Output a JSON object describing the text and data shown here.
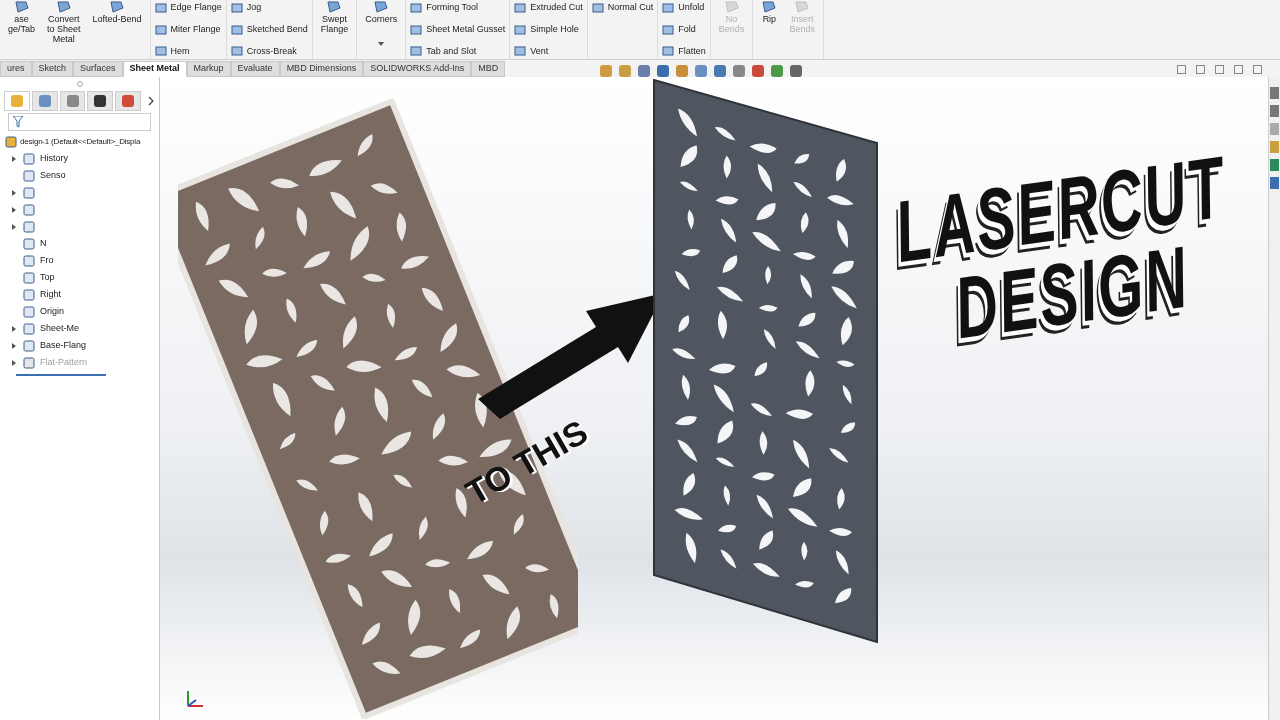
{
  "ribbon": {
    "groups": [
      {
        "kind": "large",
        "items": [
          {
            "label": "ase\nge/Tab",
            "disabled": false
          },
          {
            "label": "Convert\nto Sheet\nMetal",
            "disabled": false
          },
          {
            "label": "Lofted-Bend",
            "disabled": false
          }
        ]
      },
      {
        "kind": "small",
        "items": [
          {
            "label": "Edge Flange",
            "disabled": false
          },
          {
            "label": "Miter Flange",
            "disabled": false
          },
          {
            "label": "Hem",
            "disabled": false
          }
        ]
      },
      {
        "kind": "small",
        "items": [
          {
            "label": "Jog",
            "disabled": false
          },
          {
            "label": "Sketched Bend",
            "disabled": false
          },
          {
            "label": "Cross-Break",
            "disabled": false
          }
        ]
      },
      {
        "kind": "large",
        "items": [
          {
            "label": "Swept\nFlange",
            "disabled": false
          }
        ]
      },
      {
        "kind": "dropdown",
        "items": [
          {
            "label": "Corners",
            "disabled": false
          }
        ]
      },
      {
        "kind": "small",
        "items": [
          {
            "label": "Forming Tool",
            "disabled": false
          },
          {
            "label": "Sheet Metal Gusset",
            "disabled": false
          },
          {
            "label": "Tab and Slot",
            "disabled": false
          }
        ]
      },
      {
        "kind": "small",
        "items": [
          {
            "label": "Extruded Cut",
            "disabled": false
          },
          {
            "label": "Simple Hole",
            "disabled": false
          },
          {
            "label": "Vent",
            "disabled": false
          }
        ]
      },
      {
        "kind": "small",
        "items": [
          {
            "label": "Normal Cut",
            "disabled": false
          }
        ]
      },
      {
        "kind": "small",
        "items": [
          {
            "label": "Unfold",
            "disabled": false
          },
          {
            "label": "Fold",
            "disabled": false
          },
          {
            "label": "Flatten",
            "disabled": false
          }
        ]
      },
      {
        "kind": "large",
        "items": [
          {
            "label": "No\nBends",
            "disabled": true
          }
        ]
      },
      {
        "kind": "large",
        "items": [
          {
            "label": "Rip",
            "disabled": false
          },
          {
            "label": "Insert\nBends",
            "disabled": true
          }
        ]
      }
    ]
  },
  "tabs": [
    {
      "label": "ures",
      "selected": false
    },
    {
      "label": "Sketch",
      "selected": false
    },
    {
      "label": "Surfaces",
      "selected": false
    },
    {
      "label": "Sheet Metal",
      "selected": true
    },
    {
      "label": "Markup",
      "selected": false
    },
    {
      "label": "Evaluate",
      "selected": false
    },
    {
      "label": "MBD Dimensions",
      "selected": false
    },
    {
      "label": "SOLIDWORKS Add-Ins",
      "selected": false
    },
    {
      "label": "MBD",
      "selected": false
    }
  ],
  "panel_tabs": [
    {
      "selected": true
    },
    {
      "selected": false
    },
    {
      "selected": false
    },
    {
      "selected": false
    },
    {
      "selected": false
    }
  ],
  "tree": {
    "root": "design-1 (Default<<Default>_Displa",
    "items": [
      {
        "label": "History",
        "expandable": true,
        "disabled": false
      },
      {
        "label": "Senso",
        "expandable": false,
        "disabled": false
      },
      {
        "expandable": true,
        "disabled": false
      },
      {
        "expandable": true,
        "disabled": false
      },
      {
        "expandable": true,
        "disabled": false
      },
      {
        "label": "N",
        "expandable": false,
        "disabled": false
      },
      {
        "label": "Fro",
        "expandable": false,
        "disabled": false
      },
      {
        "label": "Top",
        "expandable": false,
        "disabled": false
      },
      {
        "label": "Right",
        "expandable": false,
        "disabled": false
      },
      {
        "label": "Origin",
        "expandable": false,
        "disabled": false
      },
      {
        "label": "Sheet-Me",
        "expandable": true,
        "disabled": false
      },
      {
        "label": "Base-Flang",
        "expandable": true,
        "disabled": false
      },
      {
        "label": "Flat-Pattern",
        "expandable": true,
        "disabled": true
      }
    ]
  },
  "overlay": {
    "caption": "TO THIS",
    "title_lines": [
      "LASERCUT",
      "DESIGN"
    ]
  }
}
